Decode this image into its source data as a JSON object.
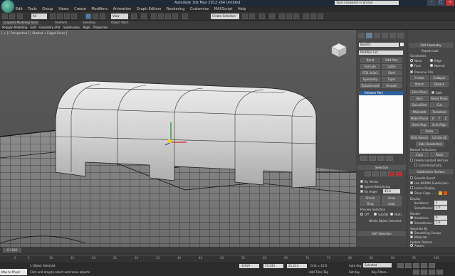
{
  "window": {
    "title": "Autodesk 3ds Max 2012 x64  Untitled",
    "search_placeholder": "Type a keyword or phrase"
  },
  "menu": [
    "Edit",
    "Tools",
    "Group",
    "Views",
    "Create",
    "Modifiers",
    "Animation",
    "Graph Editors",
    "Rendering",
    "Customize",
    "MAXScript",
    "Help"
  ],
  "toolbar": {
    "filter": "All",
    "ref_coord": "View",
    "selection_set": "Create Selection Se"
  },
  "ribbon": {
    "tabs": [
      "Graphite Modeling Tools",
      "Freeform",
      "Selection",
      "Object Paint"
    ],
    "subtabs": [
      "Polygon Modeling",
      "Edit",
      "Geometry (All)",
      "Subdivision",
      "Align",
      "Properties"
    ]
  },
  "viewport": {
    "label": "[ + ] [ Perspective ] [ Shaded + Edged Faces ]"
  },
  "command": {
    "object_name": "Box001",
    "modifier_list": "Modifier List",
    "mod_buttons": [
      [
        "Bend",
        "Edit Poly"
      ],
      [
        "Extrude",
        "Lathe"
      ],
      [
        "FFD 3x3x3",
        "Shell"
      ],
      [
        "Symmetry",
        "Taper"
      ],
      [
        "TurboSmooth",
        "Smooth"
      ]
    ],
    "stack_item": "Editable Poly",
    "selection_title": "Selection",
    "by_vertex": "By Vertex",
    "ignore_backfacing": "Ignore Backfacing",
    "by_angle": "By Angle:",
    "angle": "45.0",
    "shrink": "Shrink",
    "grow": "Grow",
    "ring": "Ring",
    "loop": "Loop",
    "preview_selection": "Preview Selection",
    "off": "Off",
    "subobj": "SubObj",
    "multi": "Multi",
    "whole_object": "Whole Object Selected",
    "soft_selection": "Soft Selection"
  },
  "edit_geometry": {
    "title": "Edit Geometry",
    "repeat_last": "Repeat Last",
    "constraints": "Constraints",
    "none": "None",
    "edge": "Edge",
    "face": "Face",
    "normal": "Normal",
    "preserve_uvs": "Preserve UVs",
    "create": "Create",
    "collapse": "Collapse",
    "attach": "Attach",
    "detach": "Detach",
    "slice_plane": "Slice Plane",
    "split": "Split",
    "slice": "Slice",
    "reset_plane": "Reset Plane",
    "quickslice": "QuickSlice",
    "cut": "Cut",
    "msmooth": "MSmooth",
    "tessellate": "Tessellate",
    "make_planar": "Make Planar",
    "x": "X",
    "y": "Y",
    "z": "Z",
    "view_align": "View Align",
    "grid_align": "Grid Align",
    "relax": "Relax",
    "hide_selected": "Hide Selected",
    "unhide_all": "Unhide All",
    "hide_unselected": "Hide Unselected",
    "named_selections": "Named Selections:",
    "copy": "Copy",
    "paste": "Paste",
    "delete_isolated": "Delete Isolated Vertices",
    "full_interactivity": "Full Interactivity",
    "subdiv_title": "Subdivision Surface",
    "smooth_result": "Smooth Result",
    "use_nurms": "Use NURMS Subdivision",
    "isoline": "Isoline Display",
    "show_cage": "Show Cage......",
    "display": "Display",
    "iterations": "Iterations:",
    "iter_val": "1",
    "smoothness": "Smoothness:",
    "smooth_val": "1.0",
    "render": "Render",
    "iter_val2": "0",
    "smooth_val2": "1.0",
    "separate_by": "Separate By",
    "smoothing_groups": "Smoothing Groups",
    "materials": "Materials",
    "update_options": "Update Options",
    "always": "Always",
    "when_rendering": "When Rendering",
    "manually": "Manually"
  },
  "timeline": {
    "frame": "0 / 100",
    "ticks": [
      "0",
      "5",
      "10",
      "15",
      "20",
      "25",
      "30",
      "35",
      "40",
      "45",
      "50",
      "55",
      "60",
      "65",
      "70",
      "75",
      "80",
      "85",
      "90",
      "95",
      "100"
    ]
  },
  "status": {
    "maxscript": "Max to Physc",
    "selected": "1 Object Selected",
    "hint": "Click and drag to select and move objects",
    "x": "-6.919",
    "y": "75.033",
    "z": "25.213",
    "grid": "Grid = 10.0",
    "add_time_tag": "Add Time Tag",
    "auto_key": "Auto Key",
    "selected_dd": "Selected",
    "set_key": "Set Key",
    "key_filters": "Key Filters..."
  },
  "colors": {
    "accent": "#4b7fb6",
    "selected": "#2f5f9a",
    "cage1": "#e8b020",
    "cage2": "#d85a1a",
    "red": "#cc2222"
  }
}
